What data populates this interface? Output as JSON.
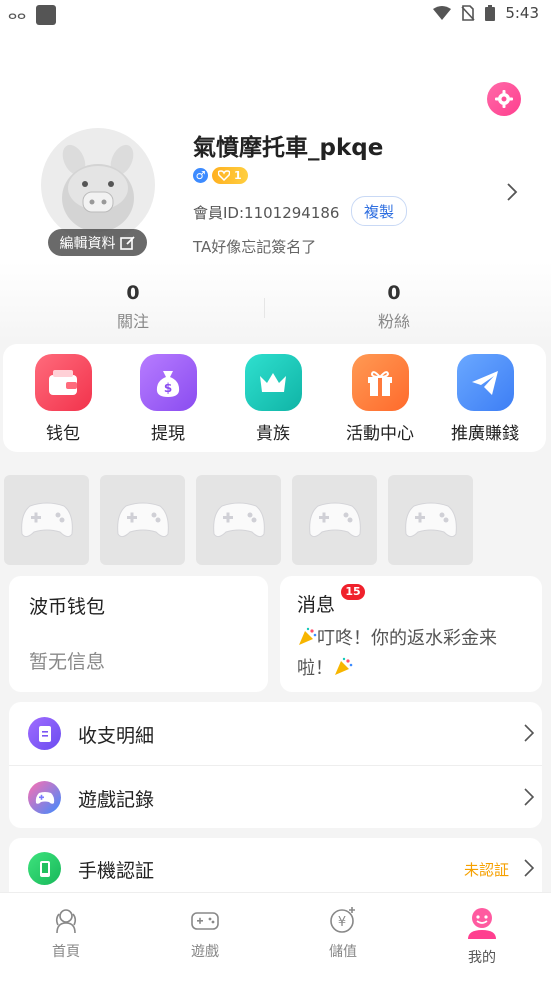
{
  "status_bar": {
    "time": "5:43",
    "left_glyph": "ⴰⴰ"
  },
  "profile": {
    "username": "氣憤摩托車_pkqe",
    "gender_symbol": "♂",
    "level": "1",
    "member_id": "會員ID:1101294186",
    "copy_label": "複製",
    "signature": "TA好像忘記簽名了",
    "edit_label": "編輯資料"
  },
  "stats": {
    "following": {
      "count": "0",
      "label": "關注"
    },
    "followers": {
      "count": "0",
      "label": "粉絲"
    }
  },
  "quick_menu": [
    {
      "label": "钱包",
      "icon": "wallet-icon",
      "color": "#ff4a5f"
    },
    {
      "label": "提現",
      "icon": "money-bag-icon",
      "color": "#9b5cf6"
    },
    {
      "label": "貴族",
      "icon": "crown-icon",
      "color": "#16c9b9"
    },
    {
      "label": "活動中心",
      "icon": "gift-icon",
      "color": "#ff7a3c"
    },
    {
      "label": "推廣賺錢",
      "icon": "paper-plane-icon",
      "color": "#3d8bff"
    }
  ],
  "wallet_card": {
    "title": "波币钱包",
    "empty_text": "暂无信息"
  },
  "message_card": {
    "title": "消息",
    "badge": "15",
    "text": "叮咚！你的返水彩金来啦！"
  },
  "list": [
    {
      "label": "收支明細",
      "icon": "document-icon",
      "status": ""
    },
    {
      "label": "遊戲記錄",
      "icon": "gamepad-icon",
      "status": ""
    },
    {
      "label": "手機認証",
      "icon": "phone-icon",
      "status": "未認証"
    }
  ],
  "bottom_nav": [
    {
      "label": "首頁",
      "icon": "home-icon"
    },
    {
      "label": "遊戲",
      "icon": "game-icon"
    },
    {
      "label": "儲值",
      "icon": "recharge-icon"
    },
    {
      "label": "我的",
      "icon": "profile-icon"
    }
  ],
  "colors": {
    "accent_pink": "#ff3f8f",
    "link_blue": "#2f6fe0",
    "status_orange": "#f5a000"
  }
}
